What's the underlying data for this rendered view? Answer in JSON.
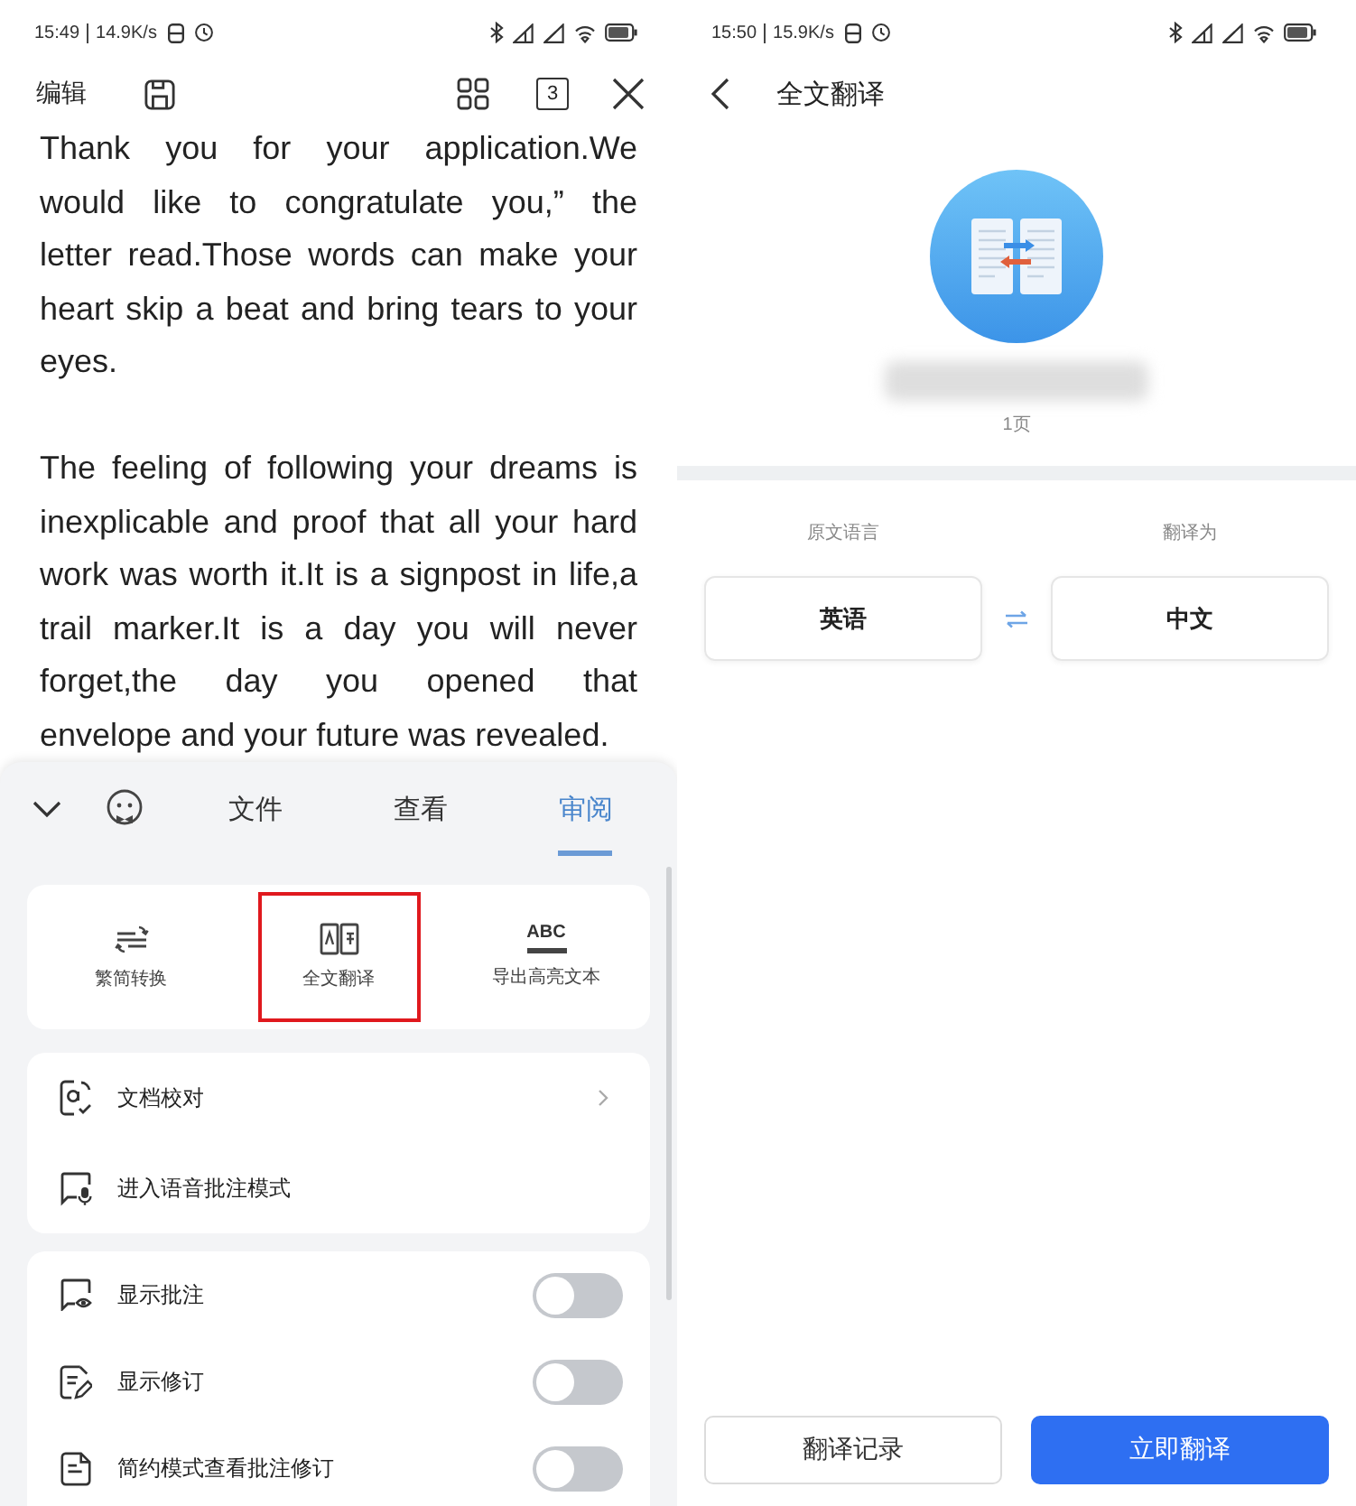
{
  "left_screen": {
    "status_bar": {
      "time": "15:49",
      "net_speed": "14.9K/s"
    },
    "toolbar": {
      "edit_label": "编辑",
      "page_count": "3"
    },
    "document": {
      "paragraphs": [
        {
          "lines": [
            "Thank you for your application.We",
            "would like to congratulate you,” the",
            "letter read.Those words can make your",
            "heart skip a beat and bring tears to your",
            "eyes."
          ]
        },
        {
          "lines": [
            "The feeling of following your dreams is",
            "inexplicable and proof that all your hard",
            "work was worth it.It is a signpost in life,a",
            "trail marker.It is a day you will never",
            "forget,the day you opened that",
            "envelope and your future was revealed."
          ]
        }
      ]
    },
    "bottom_sheet": {
      "tabs": [
        {
          "label": "文件",
          "selected": false
        },
        {
          "label": "查看",
          "selected": false
        },
        {
          "label": "审阅",
          "selected": true
        }
      ],
      "tools": [
        {
          "kind": "convert",
          "label": "繁简转换",
          "highlighted": false
        },
        {
          "kind": "translate",
          "label": "全文翻译",
          "highlighted": true
        },
        {
          "kind": "abc",
          "icon_text": "ABC",
          "label": "导出高亮文本",
          "highlighted": false
        }
      ],
      "actions": [
        {
          "kind": "proofread",
          "label": "文档校对",
          "arrow": true
        },
        {
          "kind": "voice",
          "label": "进入语音批注模式",
          "arrow": false
        }
      ],
      "toggles": [
        {
          "kind": "comments",
          "label": "显示批注",
          "on": false
        },
        {
          "kind": "revisions",
          "label": "显示修订",
          "on": false
        },
        {
          "kind": "compact",
          "label": "简约模式查看批注修订",
          "on": false
        }
      ]
    }
  },
  "right_screen": {
    "status_bar": {
      "time": "15:50",
      "net_speed": "15.9K/s"
    },
    "header": {
      "title": "全文翻译"
    },
    "file": {
      "page_count": "1页"
    },
    "languages": {
      "source_label": "原文语言",
      "source": "英语",
      "target_label": "翻译为",
      "target": "中文"
    },
    "buttons": [
      {
        "kind": "secondary",
        "label": "翻译记录"
      },
      {
        "kind": "primary",
        "label": "立即翻译"
      }
    ]
  }
}
